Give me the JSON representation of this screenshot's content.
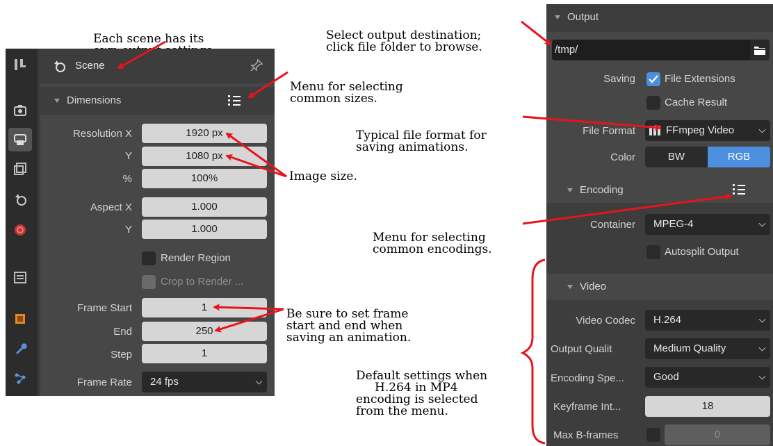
{
  "annotations": {
    "scene_note": [
      "Each scene has its",
      "own output settings."
    ],
    "sizes_menu_note": [
      "Menu for selecting",
      "common sizes."
    ],
    "image_size_note": "Image size.",
    "frame_note": [
      "Be sure to set frame",
      "start and end when",
      "saving an animation."
    ],
    "output_dest_note": [
      "Select output destination;",
      "click file folder to browse."
    ],
    "file_format_note": [
      "Typical file format for",
      "saving animations."
    ],
    "encodings_menu_note": [
      "Menu for selecting",
      "common encodings."
    ],
    "defaults_note": [
      "Default settings when",
      "     H.264 in MP4",
      "encoding is selected",
      "from the menu."
    ]
  },
  "left_panel": {
    "scene_label": "Scene",
    "dimensions_title": "Dimensions",
    "rows": {
      "resolution_x_label": "Resolution X",
      "resolution_x_value": "1920 px",
      "resolution_y_label": "Y",
      "resolution_y_value": "1080 px",
      "percent_label": "%",
      "percent_value": "100%",
      "aspect_x_label": "Aspect X",
      "aspect_x_value": "1.000",
      "aspect_y_label": "Y",
      "aspect_y_value": "1.000",
      "render_region_label": "Render Region",
      "crop_label": "Crop to Render ...",
      "frame_start_label": "Frame Start",
      "frame_start_value": "1",
      "end_label": "End",
      "end_value": "250",
      "step_label": "Step",
      "step_value": "1",
      "frame_rate_label": "Frame Rate",
      "frame_rate_value": "24 fps"
    }
  },
  "right_panel": {
    "output_title": "Output",
    "path_value": "/tmp/",
    "saving_label": "Saving",
    "file_extensions_label": "File Extensions",
    "cache_result_label": "Cache Result",
    "file_format_label": "File Format",
    "file_format_value": "FFmpeg Video",
    "color_label": "Color",
    "color_options": [
      "BW",
      "RGB"
    ],
    "color_selected": "RGB",
    "encoding_title": "Encoding",
    "container_label": "Container",
    "container_value": "MPEG-4",
    "autosplit_label": "Autosplit Output",
    "video_title": "Video",
    "video_codec_label": "Video Codec",
    "video_codec_value": "H.264",
    "output_quality_label": "Output Qualit",
    "output_quality_value": "Medium Quality",
    "encoding_speed_label": "Encoding Spe...",
    "encoding_speed_value": "Good",
    "keyframe_label": "Keyframe Int...",
    "keyframe_value": "18",
    "max_bframes_label": "Max B-frames",
    "max_bframes_value": "0"
  },
  "colors": {
    "arrow": "#e8141c",
    "accent": "#4b8fde",
    "panel": "#474747"
  }
}
